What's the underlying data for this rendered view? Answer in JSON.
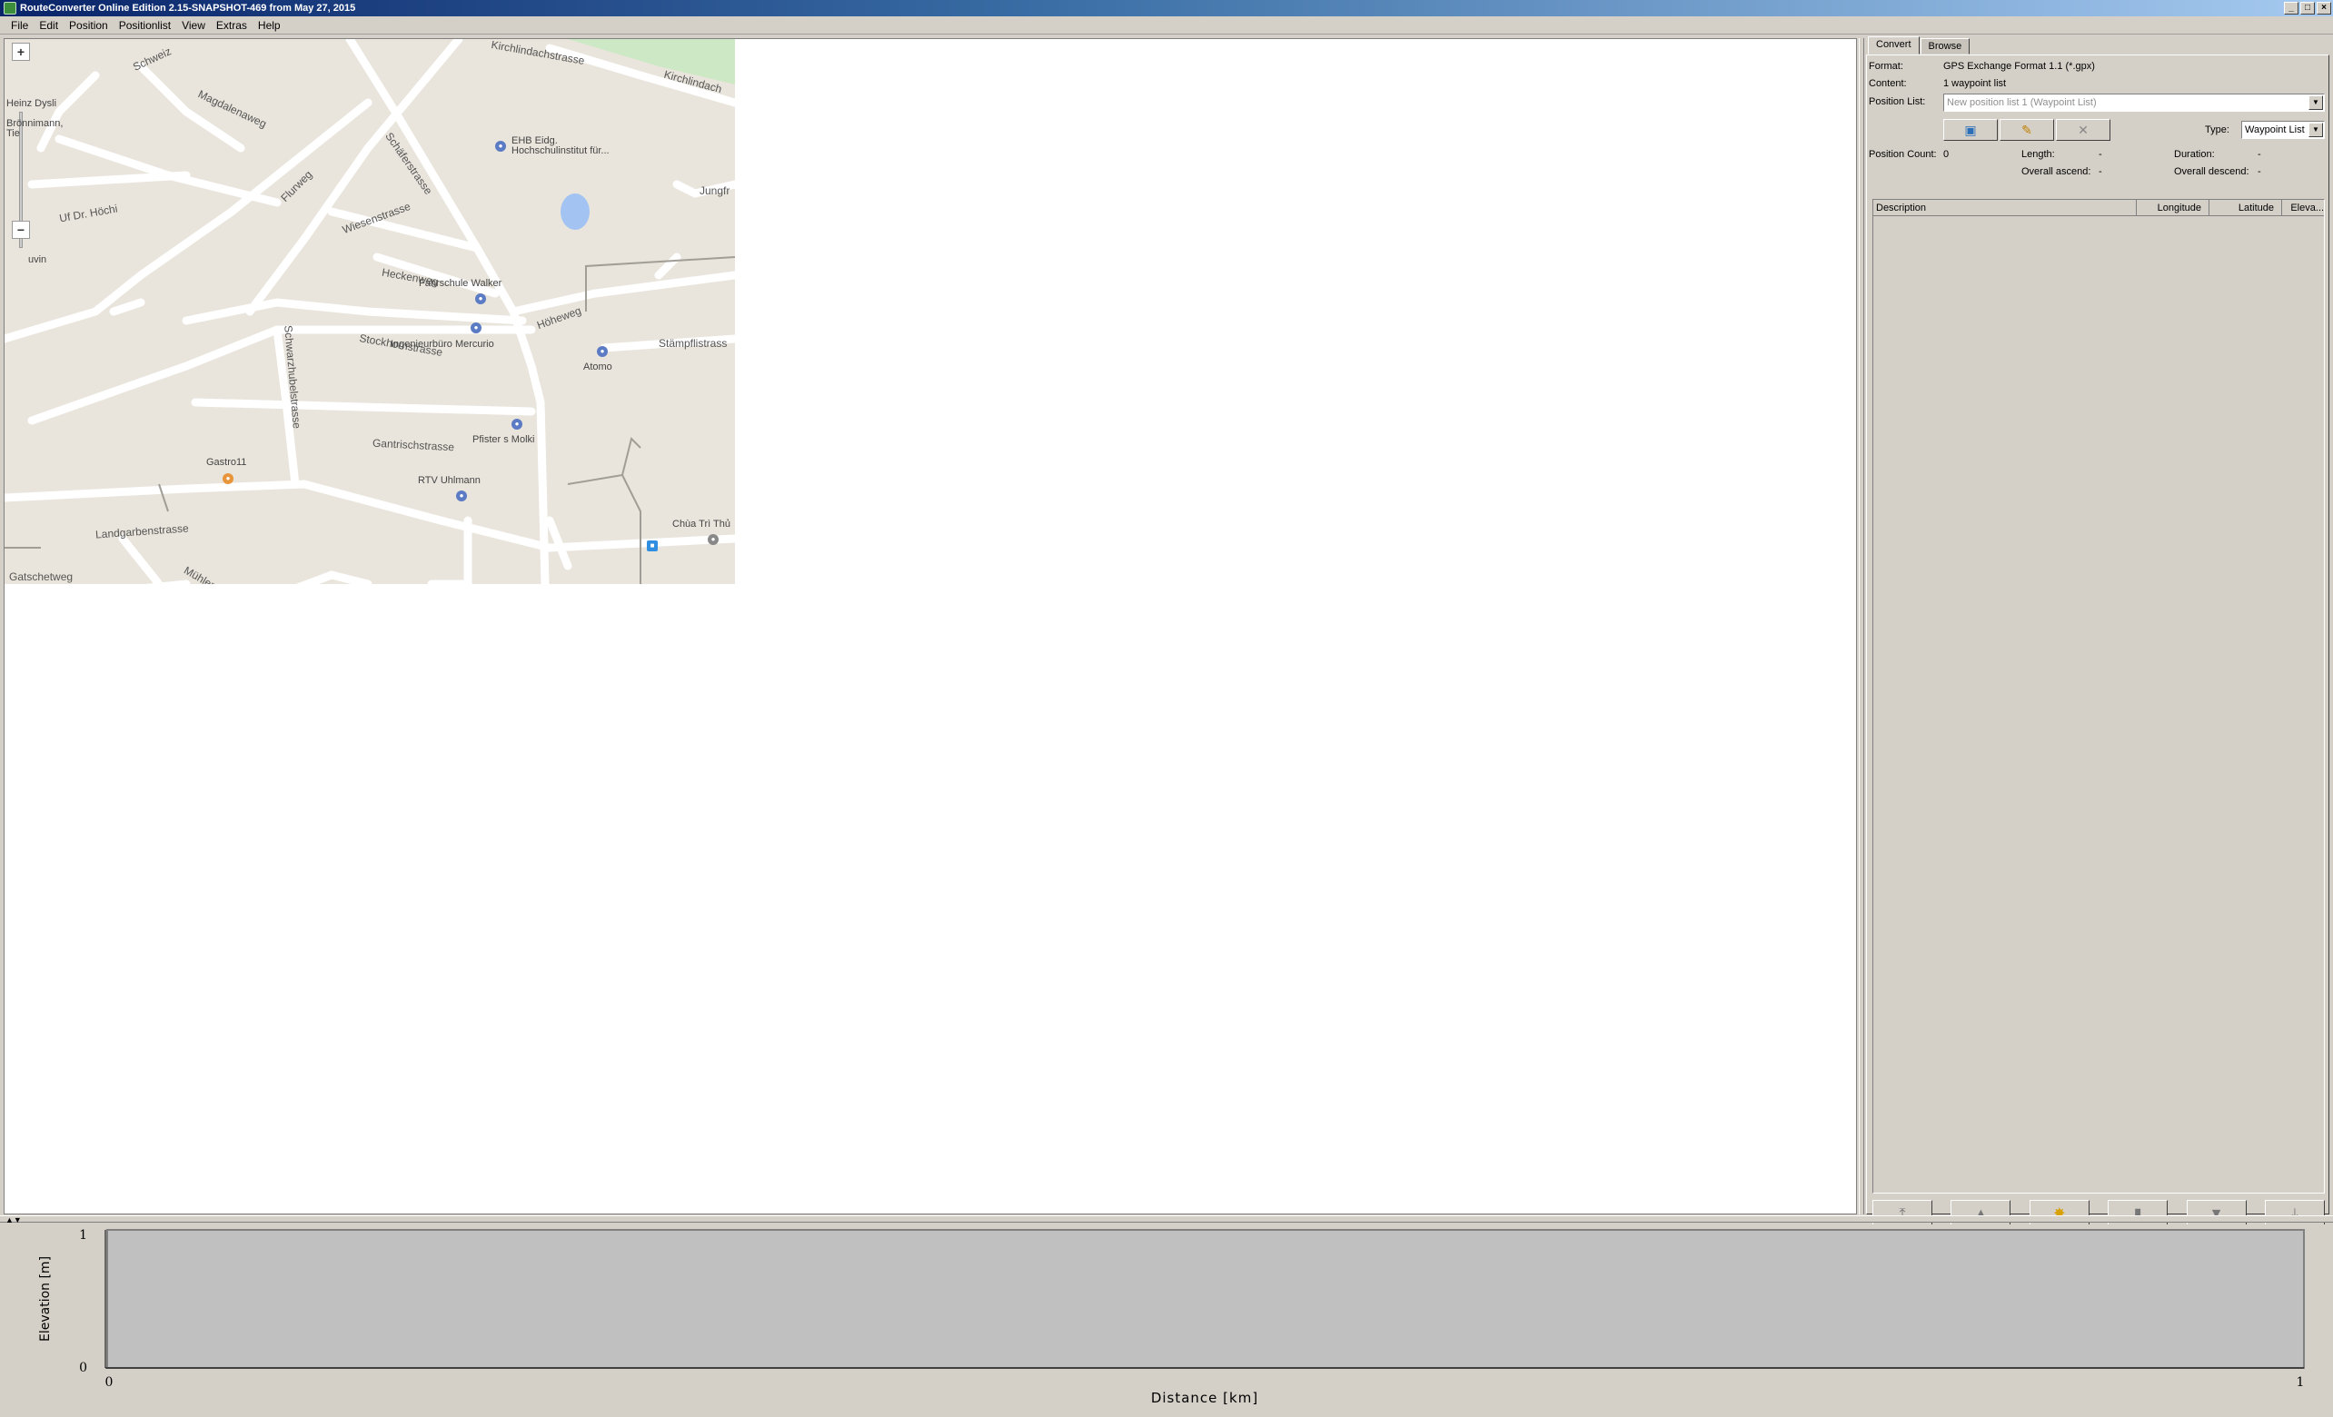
{
  "window": {
    "title": "RouteConverter Online Edition 2.15-SNAPSHOT-469 from May 27, 2015"
  },
  "menu": [
    "File",
    "Edit",
    "Position",
    "Positionlist",
    "View",
    "Extras",
    "Help"
  ],
  "map": {
    "streets": [
      "Kirchlindachstrasse",
      "Kirchlindach",
      "Magdalenaweg",
      "Schweiz",
      "Schäferstrasse",
      "Flurweg",
      "Uf Dr. Höchi",
      "Wiesenstrasse",
      "Heckenweg",
      "Höheweg",
      "Stockhornstrasse",
      "Schwarzhubelstrasse",
      "Gantrischstrasse",
      "Landgarbenstrasse",
      "Gatschetweg",
      "Mühlerain",
      "Erlachstrasse",
      "Stämpflistrass",
      "Jungfr"
    ],
    "pois": [
      "EHB Eidg. Hochschulinstitut für...",
      "Fahrschule Walker",
      "Ingenieurbüro Mercurio",
      "Atomo",
      "Pfister s Molki",
      "Gastro11",
      "RTV Uhlmann",
      "Chùa Trì Thủ",
      "Heinz Dysli",
      "Brönnimann, Tie",
      "uvin"
    ]
  },
  "panel": {
    "tabs": [
      "Convert",
      "Browse"
    ],
    "format_label": "Format:",
    "format_value": "GPS Exchange Format 1.1 (*.gpx)",
    "content_label": "Content:",
    "content_value": "1 waypoint list",
    "position_list_label": "Position List:",
    "position_list_value": "New position list 1 (Waypoint List)",
    "type_label": "Type:",
    "type_value": "Waypoint List",
    "position_count_label": "Position Count:",
    "position_count_value": "0",
    "length_label": "Length:",
    "length_value": "-",
    "duration_label": "Duration:",
    "duration_value": "-",
    "overall_ascend_label": "Overall ascend:",
    "overall_ascend_value": "-",
    "overall_descend_label": "Overall descend:",
    "overall_descend_value": "-",
    "columns": [
      "Description",
      "Longitude",
      "Latitude",
      "Eleva..."
    ]
  },
  "chart_data": {
    "type": "area",
    "xlabel": "Distance [km]",
    "ylabel": "Elevation [m]",
    "xlim": [
      0,
      1
    ],
    "ylim": [
      0,
      1
    ],
    "x_ticks": [
      "0",
      "1"
    ],
    "y_ticks": [
      "0",
      "1"
    ],
    "series": []
  }
}
